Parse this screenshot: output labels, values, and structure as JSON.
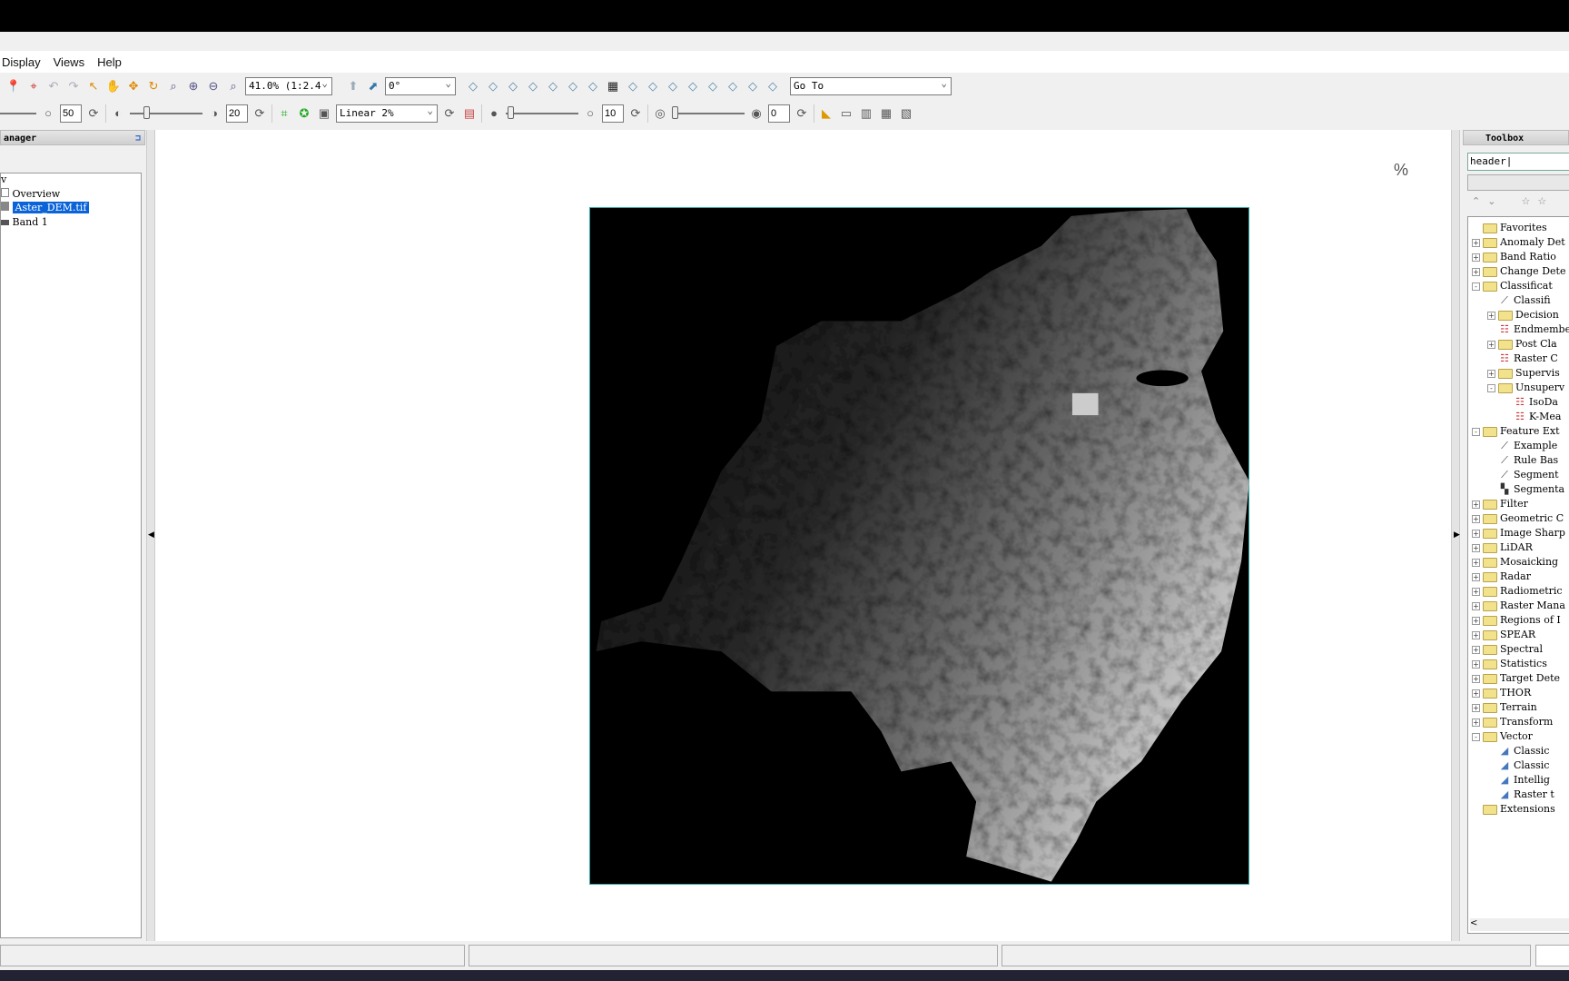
{
  "menu": [
    "Display",
    "Views",
    "Help"
  ],
  "toolbar1": {
    "icons_a": [
      "pin-icon",
      "crosshair-icon",
      "undo-icon",
      "redo-icon",
      "select-arrow-icon",
      "pan-hand-icon",
      "move-icon",
      "rotate-icon",
      "fly-icon",
      "zoom-in-icon",
      "zoom-out-icon",
      "zoom-fixed-icon"
    ],
    "zoom_value": "41.0% (1:2.4",
    "icons_b": [
      "rotate-north-icon",
      "rotate-custom-icon"
    ],
    "rotation_value": "0°",
    "icons_c": [
      "cursor-value-icon",
      "portal-icon",
      "roi-icon",
      "vector-edit-icon",
      "vector-join-icon",
      "vector-split-icon",
      "vector-merge-icon",
      "grid-icon",
      "text-annotation-icon",
      "symbol-annotation-icon",
      "polygon-annotation-icon",
      "rectangle-annotation-icon",
      "ellipse-annotation-icon",
      "polyline-annotation-icon",
      "arrow-annotation-icon",
      "picture-annotation-icon"
    ],
    "goto_value": "Go To"
  },
  "toolbar2": {
    "brightness_value": "50",
    "contrast_value": "20",
    "stretch_value": "Linear 2%",
    "sharpen_value": "10",
    "transparency_value": "0"
  },
  "left_panel": {
    "title": "anager",
    "items": [
      "Overview",
      "Aster_DEM.tif",
      "Band 1"
    ]
  },
  "toolbox": {
    "title": "Toolbox",
    "search_value": "header",
    "tree": [
      {
        "l": 0,
        "t": "folder",
        "pm": "",
        "label": "Favorites"
      },
      {
        "l": 0,
        "t": "folder",
        "pm": "+",
        "label": "Anomaly Det"
      },
      {
        "l": 0,
        "t": "folder",
        "pm": "+",
        "label": "Band Ratio"
      },
      {
        "l": 0,
        "t": "folder",
        "pm": "+",
        "label": "Change Dete"
      },
      {
        "l": 0,
        "t": "folder",
        "pm": "-",
        "label": "Classificat"
      },
      {
        "l": 1,
        "t": "wand",
        "pm": "",
        "label": "Classifi"
      },
      {
        "l": 1,
        "t": "folder",
        "pm": "+",
        "label": "Decision"
      },
      {
        "l": 1,
        "t": "tool",
        "pm": "",
        "label": "Endmembe"
      },
      {
        "l": 1,
        "t": "folder",
        "pm": "+",
        "label": "Post Cla"
      },
      {
        "l": 1,
        "t": "tool",
        "pm": "",
        "label": "Raster C"
      },
      {
        "l": 1,
        "t": "folder",
        "pm": "+",
        "label": "Supervis"
      },
      {
        "l": 1,
        "t": "folder",
        "pm": "-",
        "label": "Unsuperv"
      },
      {
        "l": 2,
        "t": "tool",
        "pm": "",
        "label": "IsoDa"
      },
      {
        "l": 2,
        "t": "tool",
        "pm": "",
        "label": "K-Mea"
      },
      {
        "l": 0,
        "t": "folder",
        "pm": "-",
        "label": "Feature Ext"
      },
      {
        "l": 1,
        "t": "wand",
        "pm": "",
        "label": "Example"
      },
      {
        "l": 1,
        "t": "wand",
        "pm": "",
        "label": "Rule Bas"
      },
      {
        "l": 1,
        "t": "wand",
        "pm": "",
        "label": "Segment"
      },
      {
        "l": 1,
        "t": "seg",
        "pm": "",
        "label": "Segmenta"
      },
      {
        "l": 0,
        "t": "folder",
        "pm": "+",
        "label": "Filter"
      },
      {
        "l": 0,
        "t": "folder",
        "pm": "+",
        "label": "Geometric C"
      },
      {
        "l": 0,
        "t": "folder",
        "pm": "+",
        "label": "Image Sharp"
      },
      {
        "l": 0,
        "t": "folder",
        "pm": "+",
        "label": "LiDAR"
      },
      {
        "l": 0,
        "t": "folder",
        "pm": "+",
        "label": "Mosaicking"
      },
      {
        "l": 0,
        "t": "folder",
        "pm": "+",
        "label": "Radar"
      },
      {
        "l": 0,
        "t": "folder",
        "pm": "+",
        "label": "Radiometric"
      },
      {
        "l": 0,
        "t": "folder",
        "pm": "+",
        "label": "Raster Mana"
      },
      {
        "l": 0,
        "t": "folder",
        "pm": "+",
        "label": "Regions of I"
      },
      {
        "l": 0,
        "t": "folder",
        "pm": "+",
        "label": "SPEAR"
      },
      {
        "l": 0,
        "t": "folder",
        "pm": "+",
        "label": "Spectral"
      },
      {
        "l": 0,
        "t": "folder",
        "pm": "+",
        "label": "Statistics"
      },
      {
        "l": 0,
        "t": "folder",
        "pm": "+",
        "label": "Target Dete"
      },
      {
        "l": 0,
        "t": "folder",
        "pm": "+",
        "label": "THOR"
      },
      {
        "l": 0,
        "t": "folder",
        "pm": "+",
        "label": "Terrain"
      },
      {
        "l": 0,
        "t": "folder",
        "pm": "+",
        "label": "Transform"
      },
      {
        "l": 0,
        "t": "folder",
        "pm": "-",
        "label": "Vector"
      },
      {
        "l": 1,
        "t": "vec",
        "pm": "",
        "label": "Classic"
      },
      {
        "l": 1,
        "t": "vec",
        "pm": "",
        "label": "Classic"
      },
      {
        "l": 1,
        "t": "vec",
        "pm": "",
        "label": "Intellig"
      },
      {
        "l": 1,
        "t": "vec",
        "pm": "",
        "label": "Raster t"
      },
      {
        "l": 0,
        "t": "folder",
        "pm": "",
        "label": "Extensions"
      }
    ]
  },
  "colors": {
    "selection": "#0a64d8",
    "frame": "#33aaaa"
  }
}
